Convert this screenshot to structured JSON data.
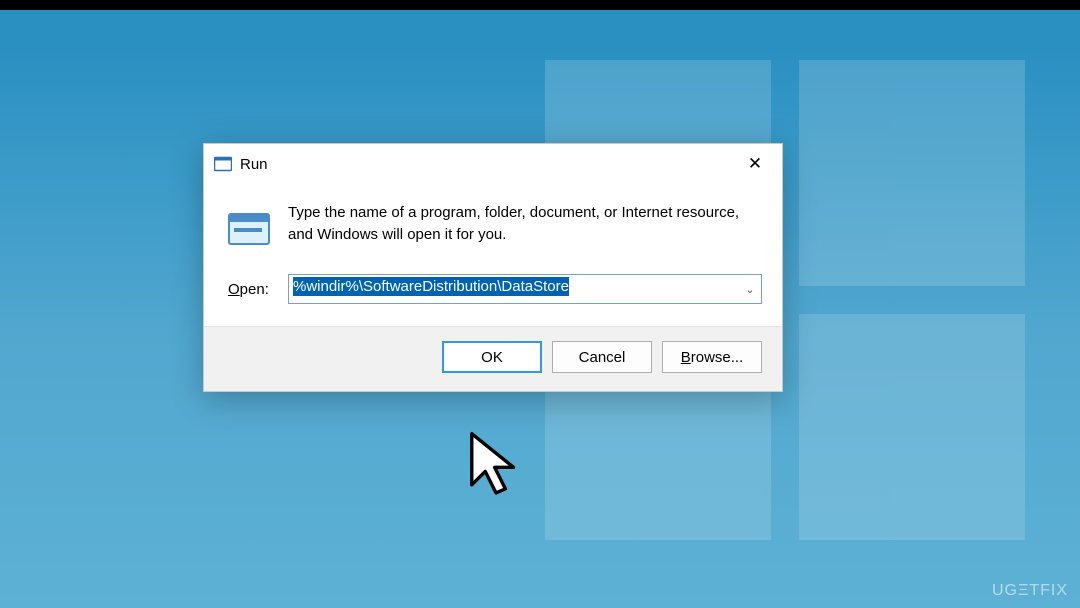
{
  "dialog": {
    "title": "Run",
    "description": "Type the name of a program, folder, document, or Internet resource, and Windows will open it for you.",
    "open_label_pre": "O",
    "open_label_post": "pen:",
    "input_value": "%windir%\\SoftwareDistribution\\DataStore",
    "ok": "OK",
    "cancel": "Cancel",
    "browse_pre": "B",
    "browse_post": "rowse...",
    "close_glyph": "✕",
    "dd_glyph": "⌄"
  },
  "watermark": "UGΞTFIX"
}
